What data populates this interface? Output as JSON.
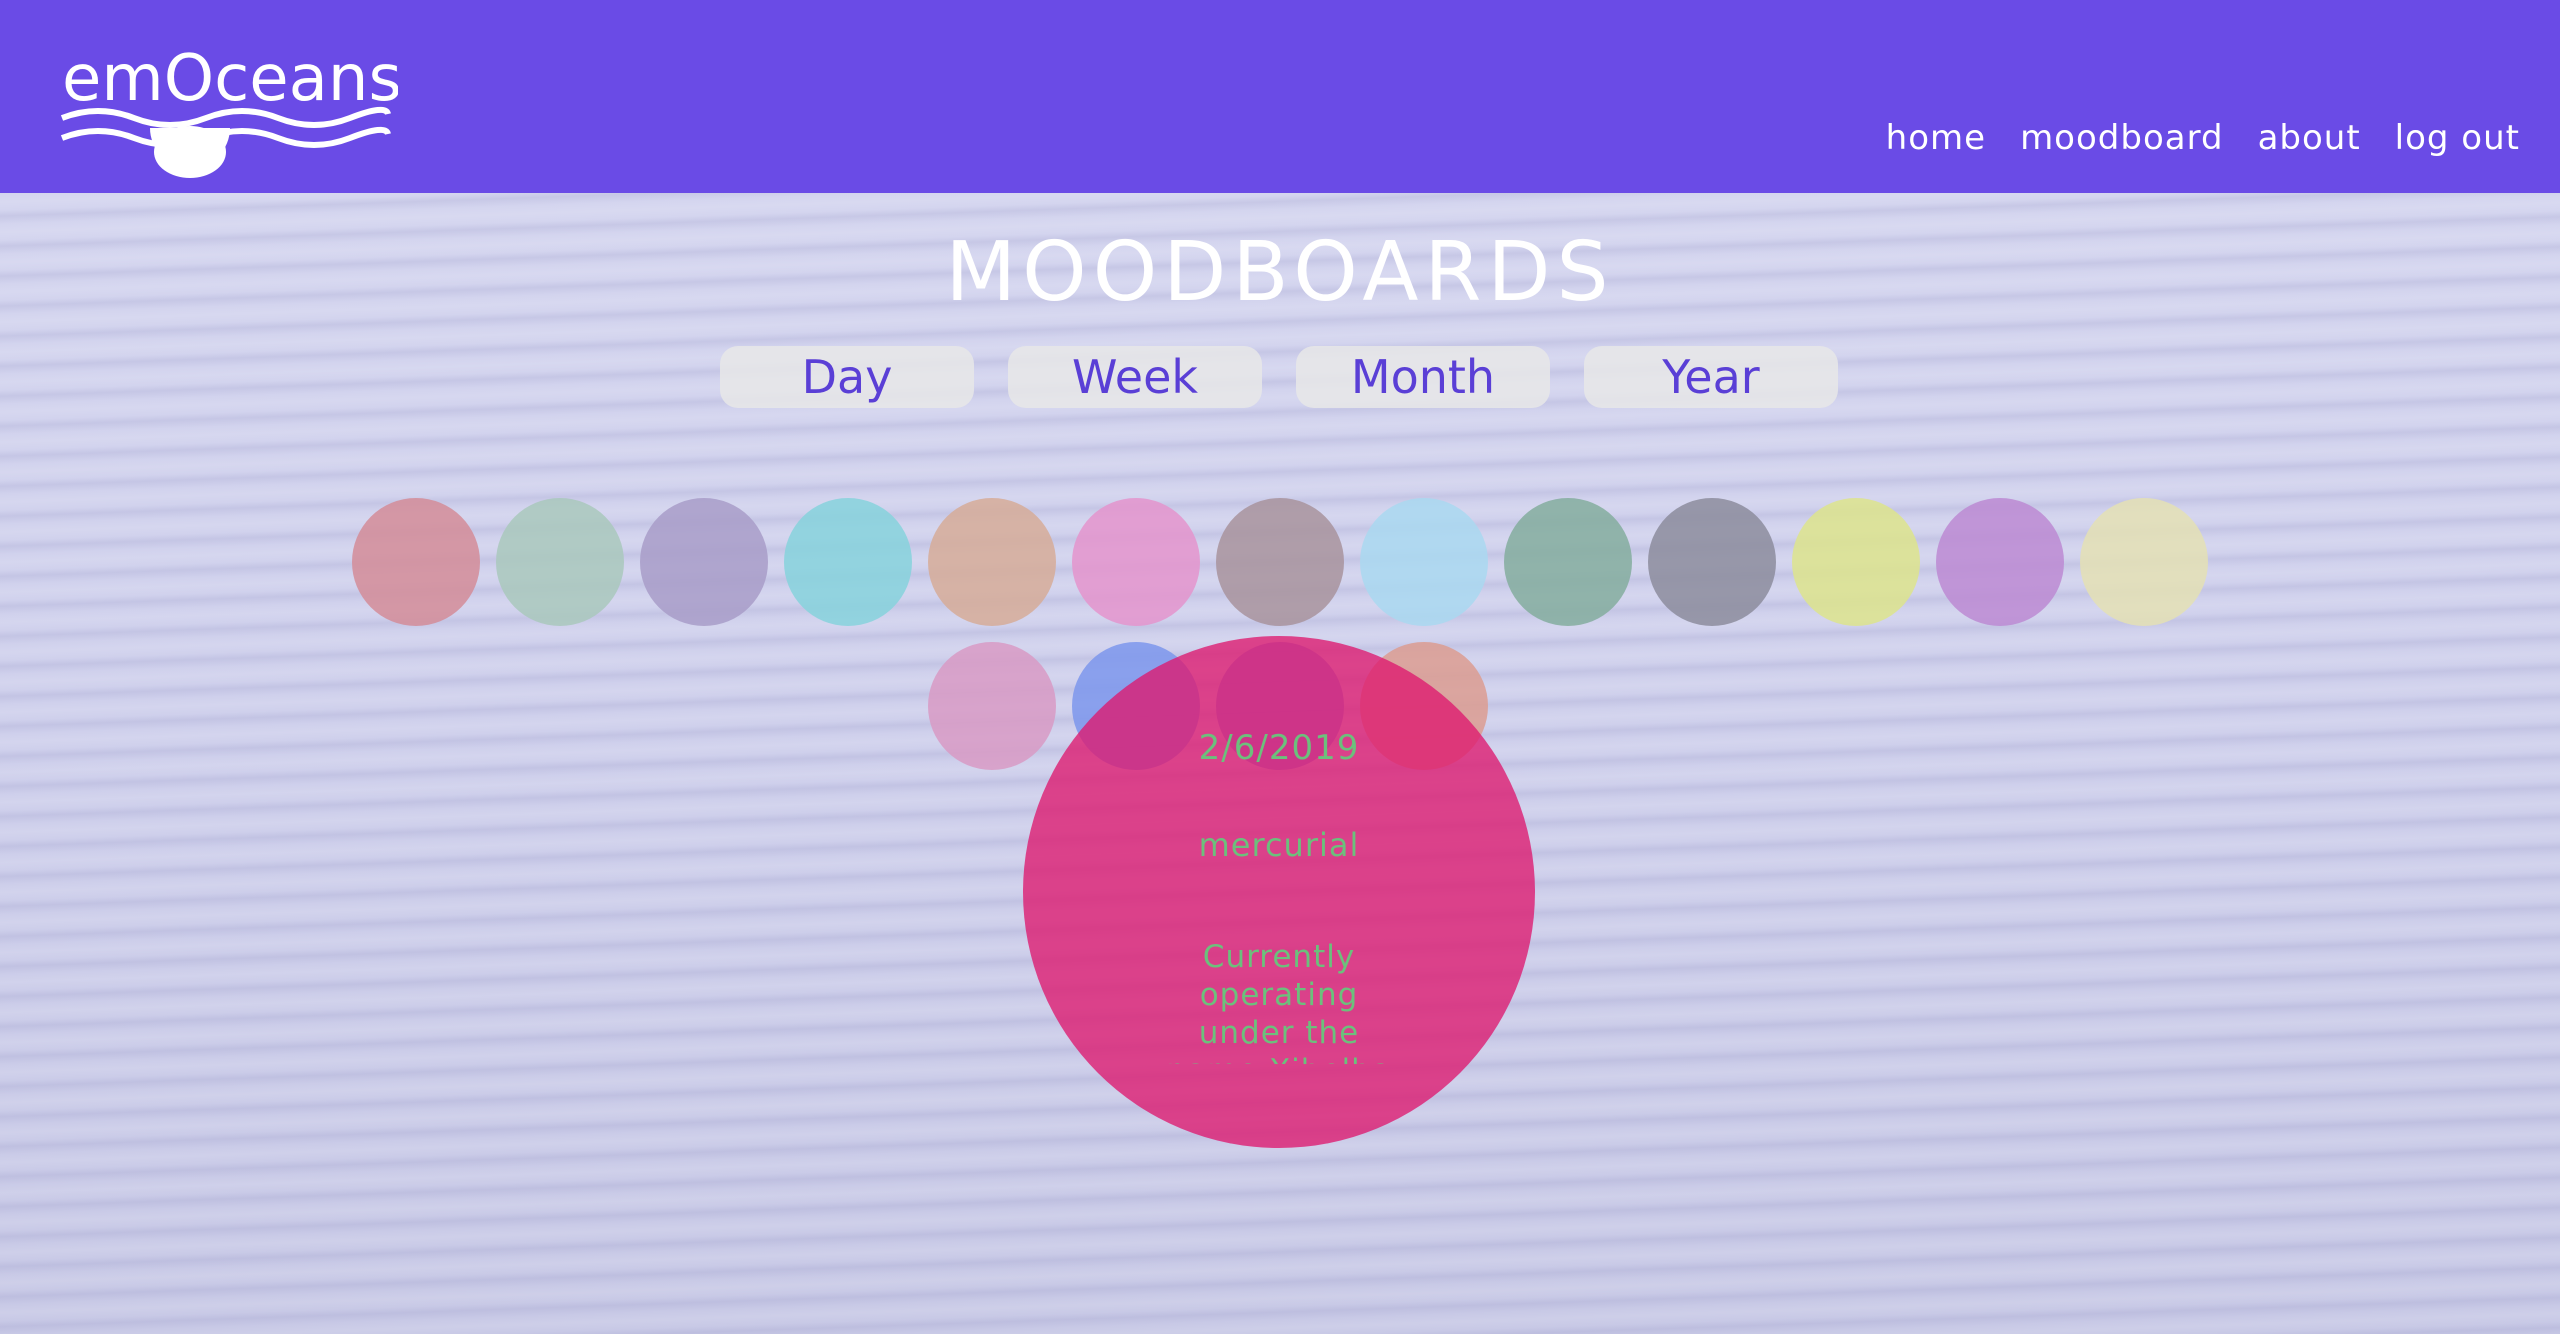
{
  "app": {
    "logo_text": "emOceans"
  },
  "nav": {
    "links": [
      {
        "label": "home"
      },
      {
        "label": "moodboard"
      },
      {
        "label": "about"
      },
      {
        "label": "log out"
      }
    ]
  },
  "page": {
    "title": "MOODBOARDS"
  },
  "tabs": [
    {
      "label": "Day"
    },
    {
      "label": "Week"
    },
    {
      "label": "Month"
    },
    {
      "label": "Year"
    }
  ],
  "mood_dots": {
    "row1": [
      "#d48c98",
      "#a9c8bc",
      "#a89cc8",
      "#86d2dc",
      "#d6ab98",
      "#e494cc",
      "#a8939c",
      "#a9d8f0",
      "#84ad9d",
      "#8c8c9c",
      "#dde48c",
      "#bc8ad2",
      "#e4e0b4"
    ],
    "row2": [
      "#d89ac4",
      "#7c96ec",
      "#8c8ce0",
      "#dc9c90"
    ]
  },
  "selected_entry": {
    "date": "2/6/2019",
    "mood": "mercurial",
    "note": "Currently operating under the name Xibelba Uxnas",
    "color": "#de186e",
    "text_color": "#6cc07c"
  }
}
